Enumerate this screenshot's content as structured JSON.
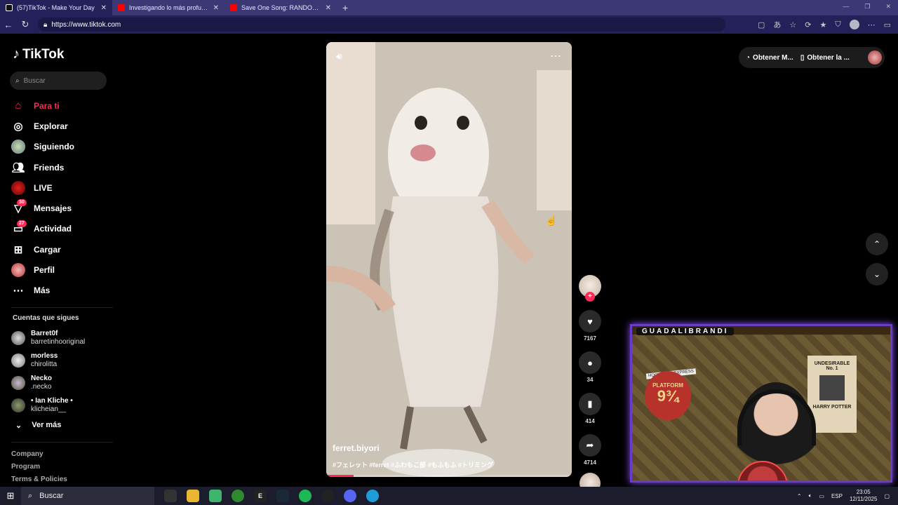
{
  "browser": {
    "tabs": [
      {
        "title": "(57)TikTok - Make Your Day",
        "active": true,
        "color": "#111111"
      },
      {
        "title": "Investigando lo más profundo de",
        "active": false,
        "color": "#ff0000"
      },
      {
        "title": "Save One Song: RANDOM Rules,",
        "active": false,
        "color": "#ff0000"
      }
    ],
    "new_tab": "+",
    "url": "https://www.tiktok.com"
  },
  "sidebar": {
    "logo": "TikTok",
    "search_placeholder": "Buscar",
    "menu": [
      {
        "label": "Para ti",
        "icon": "home-icon",
        "active": true,
        "badge": ""
      },
      {
        "label": "Explorar",
        "icon": "compass-icon",
        "active": false,
        "badge": ""
      },
      {
        "label": "Siguiendo",
        "icon": "following-avatar-icon",
        "active": false,
        "badge": ""
      },
      {
        "label": "Friends",
        "icon": "friends-icon",
        "active": false,
        "badge": ""
      },
      {
        "label": "LIVE",
        "icon": "live-icon",
        "active": false,
        "badge": ""
      },
      {
        "label": "Mensajes",
        "icon": "messages-icon",
        "active": false,
        "badge": "30"
      },
      {
        "label": "Actividad",
        "icon": "activity-icon",
        "active": false,
        "badge": "27"
      },
      {
        "label": "Cargar",
        "icon": "upload-icon",
        "active": false,
        "badge": ""
      },
      {
        "label": "Perfil",
        "icon": "profile-icon",
        "active": false,
        "badge": ""
      },
      {
        "label": "Más",
        "icon": "more-icon",
        "active": false,
        "badge": ""
      }
    ],
    "following_title": "Cuentas que sigues",
    "following": [
      {
        "name": "Barret0f",
        "user": "barretinhooriginal"
      },
      {
        "name": "morless",
        "user": "chirolitta"
      },
      {
        "name": "Necko",
        "user": ".necko"
      },
      {
        "name": "• Ian Kliche •",
        "user": "klicheian__"
      }
    ],
    "see_more": "Ver más",
    "footer": [
      "Company",
      "Program",
      "Terms & Policies"
    ]
  },
  "video": {
    "author": "ferret.biyori",
    "tags": "#フェレット #ferret #ふわもこ部 #もふもふ #トリミング",
    "progress": 0.11
  },
  "actions": {
    "likes": "7167",
    "comments": "34",
    "saves": "414",
    "shares": "4714"
  },
  "topbar": {
    "get_coins": "Obtener M...",
    "get_app": "Obtener la ..."
  },
  "webcam": {
    "name": "GUADALIBRANDI",
    "poster_platform": "PLATFORM",
    "poster_number": "9¾",
    "poster_express": "HOGWARTS EXPRESS",
    "poster_wanted_title": "UNDESIRABLE",
    "poster_wanted_no": "No. 1",
    "poster_wanted_name": "HARRY POTTER"
  },
  "taskbar": {
    "search": "Buscar",
    "lang": "ESP",
    "time": "23:05",
    "date": "12/11/2025"
  }
}
